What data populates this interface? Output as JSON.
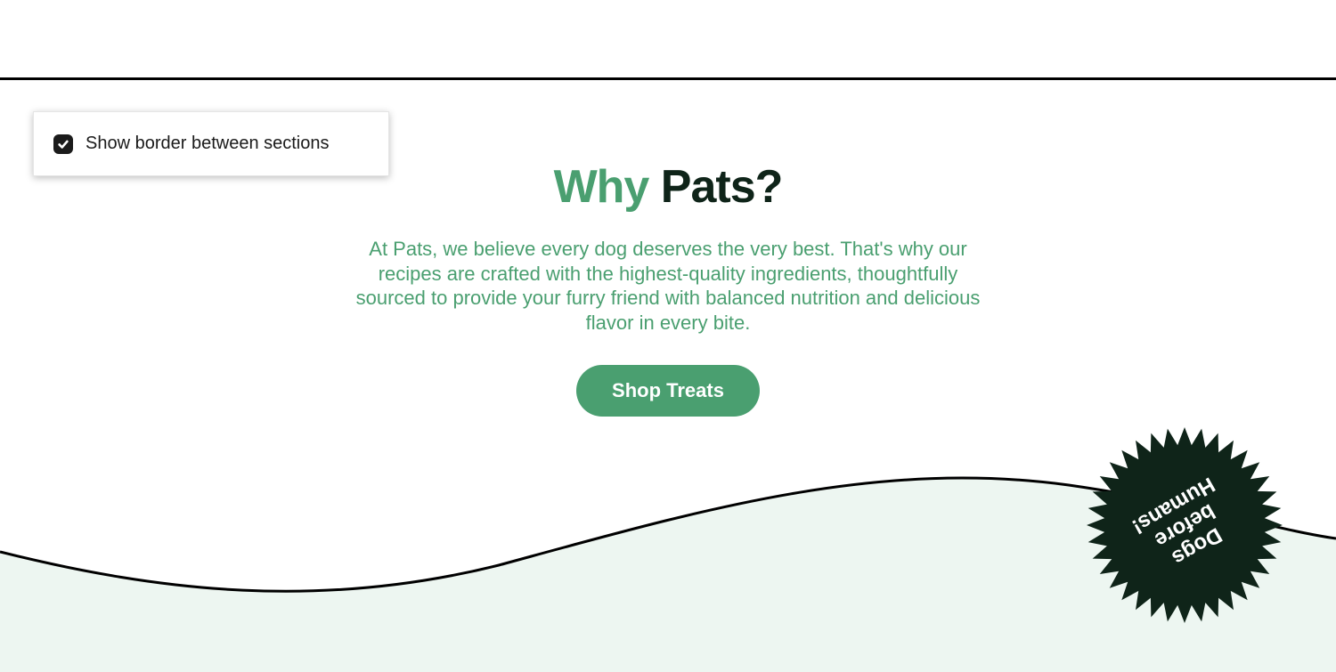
{
  "controls": {
    "show_border_label": "Show border between sections",
    "show_border_checked": true
  },
  "hero": {
    "title_accent": "Why ",
    "title_rest": "Pats?",
    "description": "At Pats, we believe every dog deserves the very best. That's why our recipes are crafted with the highest-quality ingredients, thoughtfully sourced to provide your furry friend with balanced nutrition and delicious flavor in every bite.",
    "cta_label": "Shop Treats"
  },
  "badge": {
    "line1": "Dogs",
    "line2": "before",
    "line3": "Humans!"
  },
  "colors": {
    "accent_green": "#4a9f70",
    "dark_green": "#0f2419",
    "wave_mint": "#edf6f1"
  }
}
